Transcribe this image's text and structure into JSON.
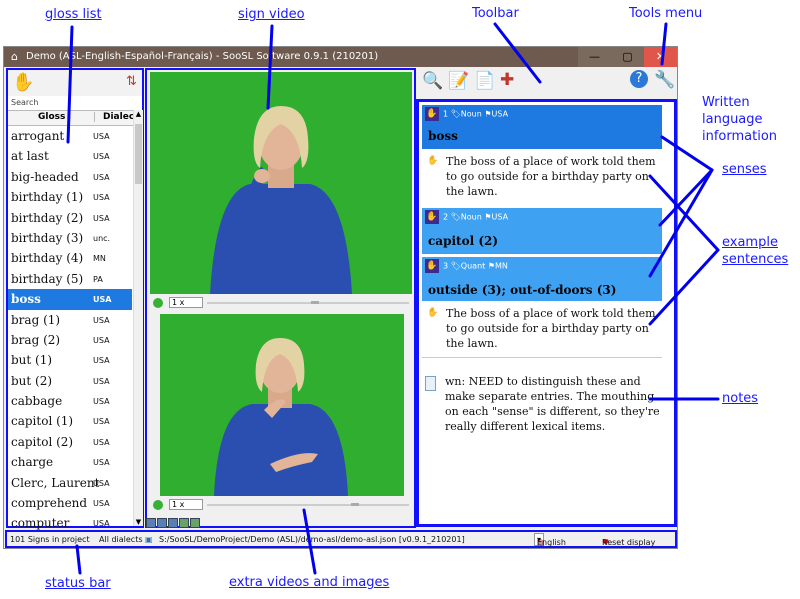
{
  "annotations": {
    "gloss_list": "gloss list",
    "sign_video": "sign video",
    "toolbar": "Toolbar",
    "tools_menu": "Tools menu",
    "written_language": [
      "Written",
      "language",
      "information"
    ],
    "senses": "senses",
    "example_sentences": [
      "example",
      "sentences"
    ],
    "notes": "notes",
    "status_bar": "status bar",
    "extra_videos": "extra videos and images"
  },
  "window": {
    "title": "Demo (ASL-English-Español-Français) - SooSL Software 0.9.1 (210201)",
    "min": "—",
    "max": "▢",
    "close": "✕"
  },
  "gloss_panel": {
    "search_label": "Search",
    "search_value": "",
    "col_gloss": "Gloss",
    "col_dialect": "Dialect",
    "rows": [
      {
        "gloss": "arrogant",
        "dialect": "USA"
      },
      {
        "gloss": "at last",
        "dialect": "USA"
      },
      {
        "gloss": "big-headed",
        "dialect": "USA"
      },
      {
        "gloss": "birthday (1)",
        "dialect": "USA"
      },
      {
        "gloss": "birthday (2)",
        "dialect": "USA"
      },
      {
        "gloss": "birthday (3)",
        "dialect": "unc."
      },
      {
        "gloss": "birthday (4)",
        "dialect": "MN"
      },
      {
        "gloss": "birthday (5)",
        "dialect": "PA"
      },
      {
        "gloss": "boss",
        "dialect": "USA"
      },
      {
        "gloss": "brag (1)",
        "dialect": "USA"
      },
      {
        "gloss": "brag (2)",
        "dialect": "USA"
      },
      {
        "gloss": "but (1)",
        "dialect": "USA"
      },
      {
        "gloss": "but (2)",
        "dialect": "USA"
      },
      {
        "gloss": "cabbage",
        "dialect": "USA"
      },
      {
        "gloss": "capitol (1)",
        "dialect": "USA"
      },
      {
        "gloss": "capitol (2)",
        "dialect": "USA"
      },
      {
        "gloss": "charge",
        "dialect": "USA"
      },
      {
        "gloss": "Clerc, Laurent",
        "dialect": "USA"
      },
      {
        "gloss": "comprehend",
        "dialect": "USA"
      },
      {
        "gloss": "computer",
        "dialect": "USA"
      }
    ],
    "selected_index": 8
  },
  "video": {
    "speed_top": "1 x",
    "speed_bottom": "1 x"
  },
  "senses": [
    {
      "num": "1",
      "pos": "Noun",
      "dialect": "USA",
      "label": "boss",
      "example": "The boss of a place of work told them to go outside for a birthday party on the lawn."
    },
    {
      "num": "2",
      "pos": "Noun",
      "dialect": "USA",
      "label": "capitol (2)",
      "example": ""
    },
    {
      "num": "3",
      "pos": "Quant",
      "dialect": "MN",
      "label": "outside (3); out-of-doors (3)",
      "example": "The boss of a place of work told them to go outside for a birthday party on the lawn."
    }
  ],
  "note": "wn: NEED to distinguish these and make separate entries. The mouthing on each \"sense\" is different, so they're really different lexical items.",
  "statusbar": {
    "count": "101 Signs in project",
    "dialects": "All dialects",
    "path": "S:/SooSL/DemoProject/Demo (ASL)/demo-asl/demo-asl.json [v0.9.1_210201]",
    "language": "English",
    "reset": "Reset display"
  }
}
